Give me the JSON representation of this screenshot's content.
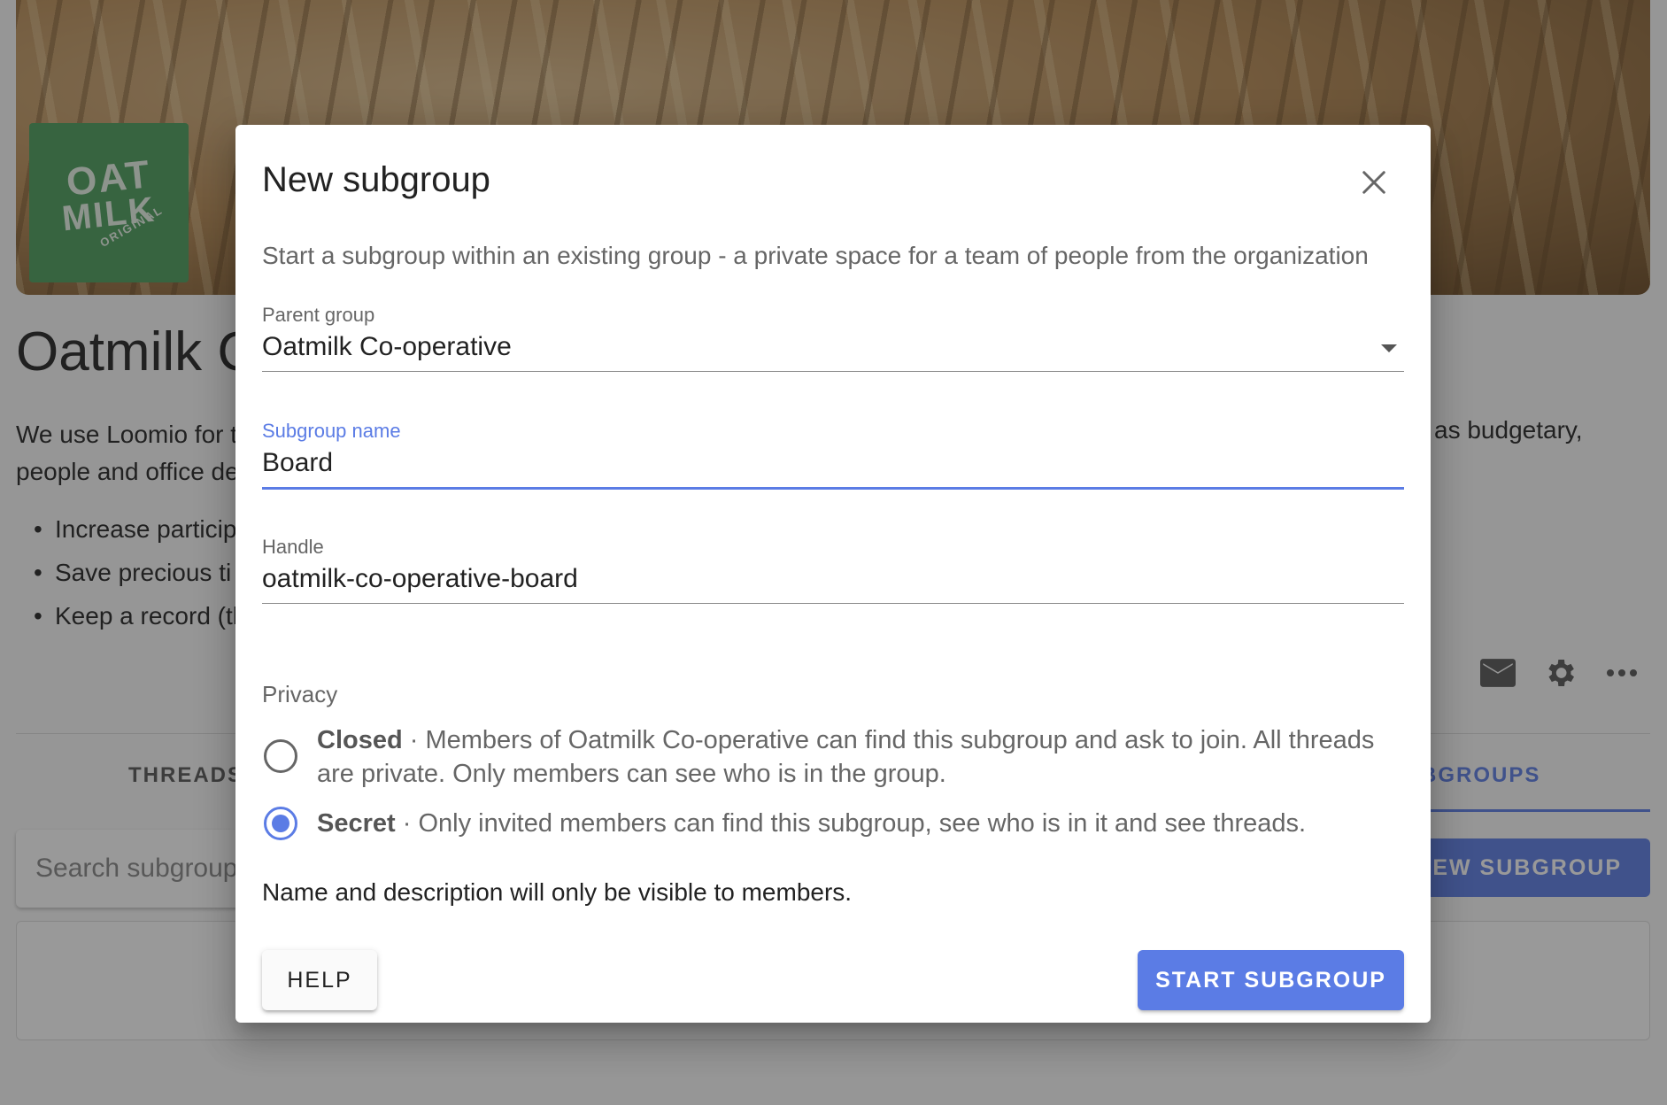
{
  "background": {
    "logo": {
      "line1": "OAT",
      "line2": "MILK",
      "line3": "ORIGINAL"
    },
    "group_title": "Oatmilk C",
    "description_left": [
      "We use Loomio for t",
      "people and office de"
    ],
    "description_right": "as budgetary,",
    "bullets": [
      "Increase particip",
      "Save precious ti",
      "Keep a record (th"
    ],
    "actions": [
      "mail-icon",
      "gear-icon",
      "more-icon"
    ],
    "tabs": {
      "threads": "THREADS",
      "subgroups": "BGROUPS"
    },
    "search": {
      "placeholder": "Search subgroups"
    },
    "new_subgroup_button": "NEW SUBGROUP"
  },
  "dialog": {
    "title": "New subgroup",
    "close_icon": "close-icon",
    "intro": "Start a subgroup within an existing group - a private space for a team of people from the organization",
    "parent_group": {
      "label": "Parent group",
      "value": "Oatmilk Co-operative"
    },
    "subgroup_name": {
      "label": "Subgroup name",
      "value": "Board"
    },
    "handle": {
      "label": "Handle",
      "value": "oatmilk-co-operative-board"
    },
    "privacy": {
      "label": "Privacy",
      "options": [
        {
          "title": "Closed",
          "description": " · Members of Oatmilk Co-operative can find this subgroup and ask to join. All threads are private. Only members can see who is in the group.",
          "selected": false
        },
        {
          "title": "Secret",
          "description": " · Only invited members can find this subgroup, see who is in it and see threads.",
          "selected": true
        }
      ]
    },
    "note": "Name and description will only be visible to members.",
    "help_button": "HELP",
    "start_button": "START SUBGROUP"
  },
  "colors": {
    "accent": "#5b7ce5",
    "logo_green": "#4a9d5c"
  }
}
